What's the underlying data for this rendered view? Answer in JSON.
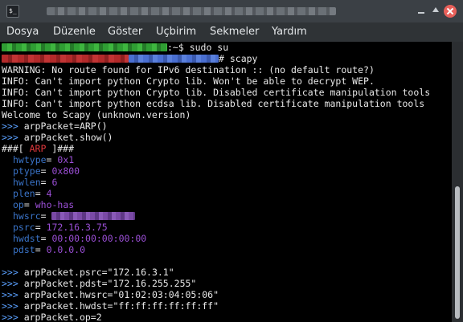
{
  "titlebar": {
    "app_icon_text": "$_",
    "title": ""
  },
  "menu": [
    "Dosya",
    "Düzenle",
    "Göster",
    "Uçbirim",
    "Sekmeler",
    "Yardım"
  ],
  "terminal": {
    "line0_suffix": ":~$ sudo su",
    "line1_suffix": "# scapy",
    "warning": "WARNING: No route found for IPv6 destination :: (no default route?)",
    "info1": "INFO: Can't import python Crypto lib. Won't be able to decrypt WEP.",
    "info2": "INFO: Can't import python Crypto lib. Disabled certificate manipulation tools",
    "info3": "INFO: Can't import python ecdsa lib. Disabled certificate manipulation tools",
    "welcome": "Welcome to Scapy (unknown.version)",
    "prompt": ">>> ",
    "cmd1": "arpPacket=ARP()",
    "cmd2": "arpPacket.show()",
    "header_left": "###[ ",
    "header_layer": "ARP",
    "header_right": " ]###",
    "fields": [
      {
        "name": "hwtype",
        "value": "0x1"
      },
      {
        "name": "ptype",
        "value": "0x800"
      },
      {
        "name": "hwlen",
        "value": "6"
      },
      {
        "name": "plen",
        "value": "4"
      },
      {
        "name": "op",
        "value": "who-has"
      },
      {
        "name": "hwsrc",
        "value": ""
      },
      {
        "name": "psrc",
        "value": "172.16.3.75"
      },
      {
        "name": "hwdst",
        "value": "00:00:00:00:00:00"
      },
      {
        "name": "pdst",
        "value": "0.0.0.0"
      }
    ],
    "eq": "= ",
    "cmd3": "arpPacket.psrc=\"172.16.3.1\"",
    "cmd4": "arpPacket.pdst=\"172.16.255.255\"",
    "cmd5": "arpPacket.hwsrc=\"01:02:03:04:05:06\"",
    "cmd6": "arpPacket.hwdst=\"ff:ff:ff:ff:ff:ff\"",
    "cmd7": "arpPacket.op=2"
  },
  "colors": {
    "prompt": "#5aa0ff",
    "layer_name": "#e0383d",
    "field_name": "#3a74c9",
    "field_value": "#9b4fd6"
  },
  "icons": {
    "app": "terminal-icon",
    "minimize": "minimize-icon",
    "maximize": "maximize-icon",
    "close": "close-icon"
  }
}
